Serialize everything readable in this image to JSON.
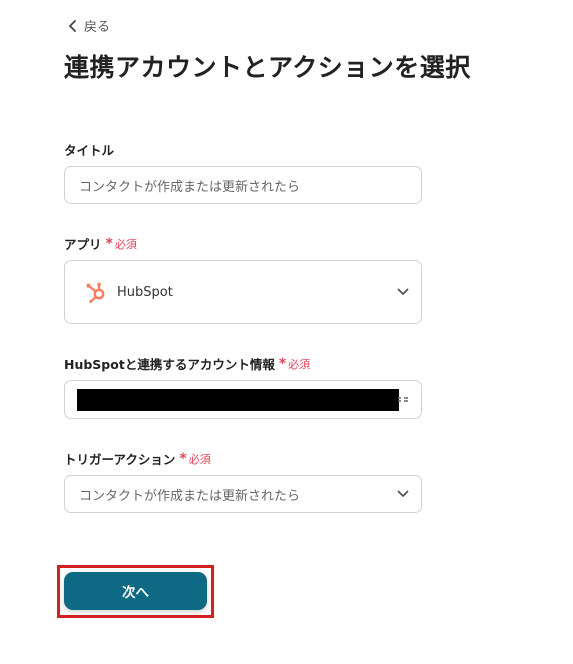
{
  "nav": {
    "back_label": "戻る"
  },
  "page": {
    "title": "連携アカウントとアクションを選択"
  },
  "form": {
    "required_label": "必須",
    "title_field": {
      "label": "タイトル",
      "value": "コンタクトが作成または更新されたら"
    },
    "app_field": {
      "label": "アプリ",
      "selected_app": "HubSpot",
      "app_icon": "hubspot-logo",
      "app_icon_color": "#ff7a59"
    },
    "account_field": {
      "label": "HubSpotと連携するアカウント情報",
      "value_redacted": true
    },
    "trigger_field": {
      "label": "トリガーアクション",
      "selected": "コンタクトが作成または更新されたら"
    }
  },
  "actions": {
    "next_label": "次へ",
    "next_color": "#0e6a84",
    "highlight_color": "#d42020"
  }
}
